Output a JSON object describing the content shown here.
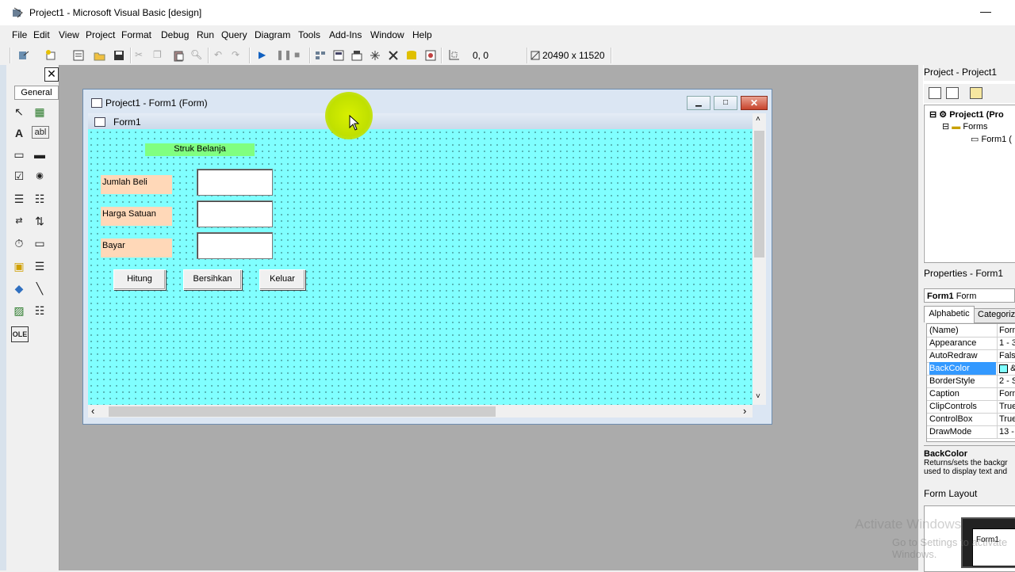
{
  "window": {
    "title": "Project1 - Microsoft Visual Basic [design]",
    "minimize": "—"
  },
  "menu": [
    "File",
    "Edit",
    "View",
    "Project",
    "Format",
    "Debug",
    "Run",
    "Query",
    "Diagram",
    "Tools",
    "Add-Ins",
    "Window",
    "Help"
  ],
  "toolbar": {
    "position": "0, 0",
    "size": "20490 x 11520"
  },
  "toolbox": {
    "close": "✕",
    "tab": "General",
    "tools": [
      "↖",
      "▦",
      "A",
      "abl",
      "▭",
      "▬",
      "☑",
      "◉",
      "☰",
      "☷",
      "⇄",
      "⇅",
      "⏱",
      "▭",
      "▣",
      "☰",
      "◆",
      "╲",
      "▨",
      "☷",
      "OLE"
    ]
  },
  "form_window": {
    "title": "Project1 - Form1 (Form)",
    "caption": "Form1",
    "controls": {
      "header_label": "Struk Belanja",
      "label1": "Jumlah Beli",
      "label2": "Harga Satuan",
      "label3": "Bayar",
      "button1": "Hitung",
      "button2": "Bersihkan",
      "button3": "Keluar"
    },
    "minimize": "▁",
    "maximize": "□",
    "close": "✕",
    "scroll_left": "‹",
    "scroll_right": "›",
    "scroll_up": "˄",
    "scroll_down": "˅"
  },
  "project": {
    "title": "Project - Project1",
    "tree": {
      "root": "Project1 (Pro",
      "folder": "Forms",
      "item": "Form1 ("
    }
  },
  "properties": {
    "title": "Properties - Form1",
    "combo_name": "Form1",
    "combo_type": "Form",
    "tab_alpha": "Alphabetic",
    "tab_cat": "Categoriz",
    "rows": [
      {
        "name": "(Name)",
        "value": "Form"
      },
      {
        "name": "Appearance",
        "value": "1 - 3"
      },
      {
        "name": "AutoRedraw",
        "value": "False"
      },
      {
        "name": "BackColor",
        "value": "&"
      },
      {
        "name": "BorderStyle",
        "value": "2 - S"
      },
      {
        "name": "Caption",
        "value": "Form"
      },
      {
        "name": "ClipControls",
        "value": "True"
      },
      {
        "name": "ControlBox",
        "value": "True"
      },
      {
        "name": "DrawMode",
        "value": "13 -"
      }
    ],
    "desc_title": "BackColor",
    "desc_line1": "Returns/sets the backgr",
    "desc_line2": "used to display text and"
  },
  "form_layout": {
    "title": "Form Layout",
    "form": "Form1"
  },
  "watermark": {
    "line1": "Activate Windows",
    "line2": "Go to Settings to activate Windows."
  },
  "colors": {
    "form_back": "#80ffff",
    "header_label": "#80ff80",
    "label_back": "#ffd8b8"
  }
}
